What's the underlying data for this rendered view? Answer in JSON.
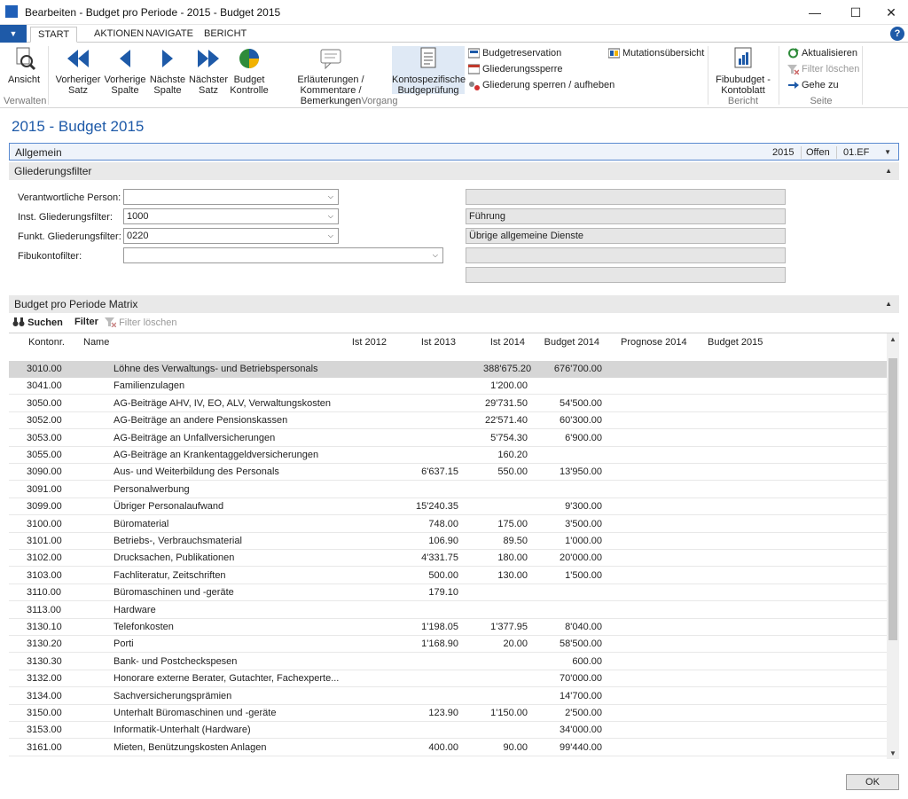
{
  "window": {
    "title": "Bearbeiten - Budget pro Periode - 2015 - Budget 2015"
  },
  "tabs": [
    "START",
    "AKTIONEN",
    "NAVIGATE",
    "BERICHT"
  ],
  "ribbon": {
    "ansicht": "Ansicht",
    "verwalten": "Verwalten",
    "vorheriger_satz": [
      "Vorheriger",
      "Satz"
    ],
    "vorherige_spalte": [
      "Vorherige",
      "Spalte"
    ],
    "naechste_spalte": [
      "Nächste",
      "Spalte"
    ],
    "naechster_satz": [
      "Nächster",
      "Satz"
    ],
    "budget_kontrolle": [
      "Budget",
      "Kontrolle"
    ],
    "erlaeuterungen": [
      "Erläuterungen /",
      "Kommentare / Bemerkungen"
    ],
    "kontospezifische": [
      "Kontospezifische",
      "Budgeprüfung"
    ],
    "budgetreservation": "Budgetreservation",
    "gliederungssperre": "Gliederungssperre",
    "gliederung_sperren": "Gliederung sperren / aufheben",
    "mutationsuebersicht": "Mutationsübersicht",
    "vorgang": "Vorgang",
    "fibubudget": [
      "Fibubudget -",
      "Kontoblatt"
    ],
    "bericht": "Bericht",
    "aktualisieren": "Aktualisieren",
    "filter_loeschen": "Filter löschen",
    "gehe_zu": "Gehe zu",
    "seite": "Seite"
  },
  "page_title": "2015 - Budget 2015",
  "allgemein": {
    "label": "Allgemein",
    "year": "2015",
    "status": "Offen",
    "code": "01.EF"
  },
  "gliederungsfilter": {
    "label": "Gliederungsfilter",
    "fields": [
      {
        "label": "Verantwortliche Person:",
        "value": "",
        "desc": ""
      },
      {
        "label": "Inst. Gliederungsfilter:",
        "value": "1000",
        "desc": "Führung"
      },
      {
        "label": "Funkt. Gliederungsfilter:",
        "value": "0220",
        "desc": "Übrige allgemeine Dienste"
      },
      {
        "label": "Fibukontofilter:",
        "value": "",
        "desc": ""
      }
    ]
  },
  "matrix": {
    "label": "Budget pro Periode Matrix",
    "tools": {
      "suchen": "Suchen",
      "filter": "Filter",
      "filter_loeschen": "Filter löschen"
    },
    "columns": [
      "Kontonr.",
      "Name",
      "Ist 2012",
      "Ist 2013",
      "Ist 2014",
      "Budget 2014",
      "Prognose 2014",
      "Budget 2015"
    ],
    "rows": [
      [
        "3010.00",
        "Löhne des Verwaltungs- und Betriebspersonals",
        "",
        "",
        "388'675.20",
        "676'700.00"
      ],
      [
        "3041.00",
        "Familienzulagen",
        "",
        "",
        "1'200.00",
        ""
      ],
      [
        "3050.00",
        "AG-Beiträge AHV, IV, EO, ALV, Verwaltungskosten",
        "",
        "",
        "29'731.50",
        "54'500.00"
      ],
      [
        "3052.00",
        "AG-Beiträge an andere Pensionskassen",
        "",
        "",
        "22'571.40",
        "60'300.00"
      ],
      [
        "3053.00",
        "AG-Beiträge an Unfallversicherungen",
        "",
        "",
        "5'754.30",
        "6'900.00"
      ],
      [
        "3055.00",
        "AG-Beiträge an Krankentaggeldversicherungen",
        "",
        "",
        "160.20",
        ""
      ],
      [
        "3090.00",
        "Aus- und Weiterbildung des Personals",
        "",
        "6'637.15",
        "550.00",
        "13'950.00"
      ],
      [
        "3091.00",
        "Personalwerbung",
        "",
        "",
        "",
        ""
      ],
      [
        "3099.00",
        "Übriger Personalaufwand",
        "",
        "15'240.35",
        "",
        "9'300.00"
      ],
      [
        "3100.00",
        "Büromaterial",
        "",
        "748.00",
        "175.00",
        "3'500.00"
      ],
      [
        "3101.00",
        "Betriebs-, Verbrauchsmaterial",
        "",
        "106.90",
        "89.50",
        "1'000.00"
      ],
      [
        "3102.00",
        "Drucksachen, Publikationen",
        "",
        "4'331.75",
        "180.00",
        "20'000.00"
      ],
      [
        "3103.00",
        "Fachliteratur, Zeitschriften",
        "",
        "500.00",
        "130.00",
        "1'500.00"
      ],
      [
        "3110.00",
        "Büromaschinen und -geräte",
        "",
        "179.10",
        "",
        ""
      ],
      [
        "3113.00",
        "Hardware",
        "",
        "",
        "",
        ""
      ],
      [
        "3130.10",
        "Telefonkosten",
        "",
        "1'198.05",
        "1'377.95",
        "8'040.00"
      ],
      [
        "3130.20",
        "Porti",
        "",
        "1'168.90",
        "20.00",
        "58'500.00"
      ],
      [
        "3130.30",
        "Bank- und Postcheckspesen",
        "",
        "",
        "",
        "600.00"
      ],
      [
        "3132.00",
        "Honorare externe Berater, Gutachter, Fachexperte...",
        "",
        "",
        "",
        "70'000.00"
      ],
      [
        "3134.00",
        "Sachversicherungsprämien",
        "",
        "",
        "",
        "14'700.00"
      ],
      [
        "3150.00",
        "Unterhalt Büromaschinen und -geräte",
        "",
        "123.90",
        "1'150.00",
        "2'500.00"
      ],
      [
        "3153.00",
        "Informatik-Unterhalt (Hardware)",
        "",
        "",
        "",
        "34'000.00"
      ],
      [
        "3161.00",
        "Mieten, Benützungskosten Anlagen",
        "",
        "400.00",
        "90.00",
        "99'440.00"
      ]
    ]
  },
  "ok_button": "OK"
}
